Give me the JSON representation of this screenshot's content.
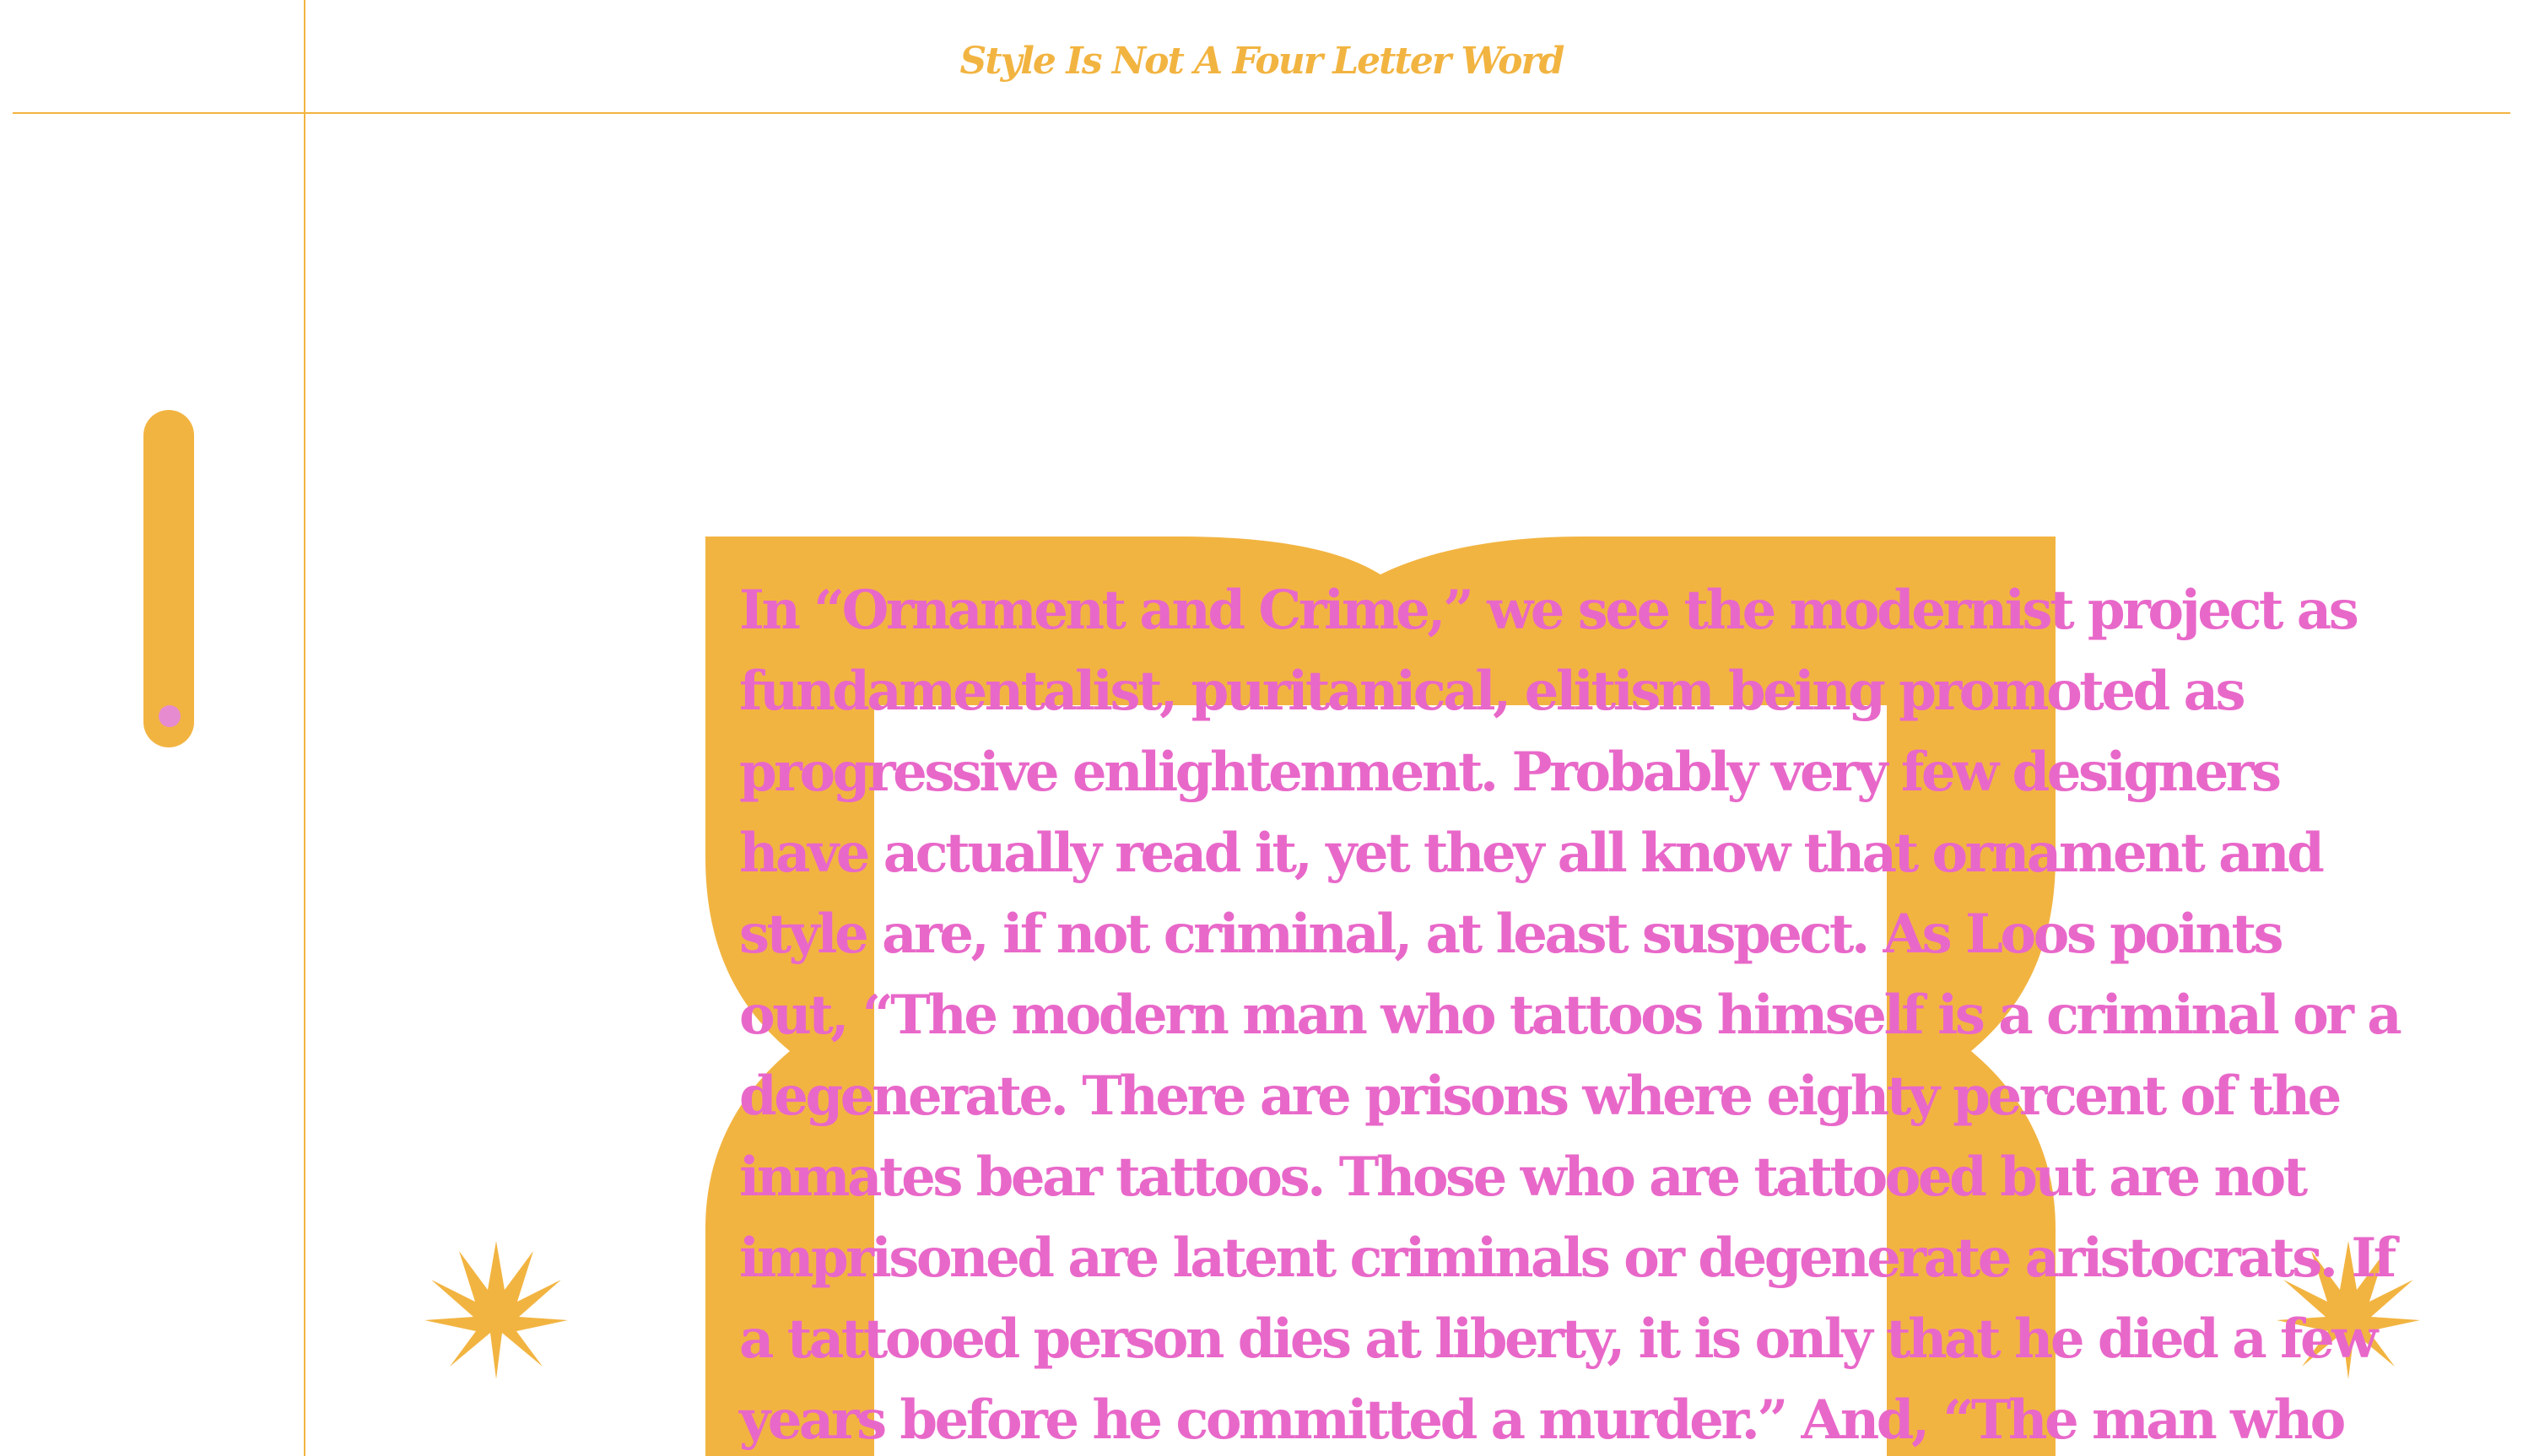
{
  "header": {
    "title": "Style Is Not A Four Letter Word"
  },
  "colors": {
    "accent_gold": "#f2b441",
    "accent_pink": "#e868c9",
    "thumb_pink": "#e78bd0",
    "background": "#ffffff"
  },
  "scroll_indicator": {
    "progress": 0.95
  },
  "decorations": {
    "left_icon": "sparkle-star-icon",
    "right_icon": "sparkle-star-icon",
    "frame": "quatrefoil-ornament"
  },
  "essay": {
    "lines": [
      "In “Ornament and Crime,” we see the modernist project as",
      "fundamentalist, puritanical, elitism being promoted as",
      "progressive enlightenment. Probably very few designers",
      "have actually read it, yet they all know that ornament and",
      "style are, if not criminal, at least suspect. As Loos points",
      "out, “The modern man who tattoos himself is a criminal or a",
      "degenerate. There are prisons where eighty percent of the",
      "inmates bear tattoos. Those who are tattooed but are not",
      "imprisoned are latent criminals or degenerate aristocrats. If",
      "a tattooed person dies at liberty, it is only that he died a few",
      "years before he committed a murder.” And, “The man who"
    ]
  }
}
